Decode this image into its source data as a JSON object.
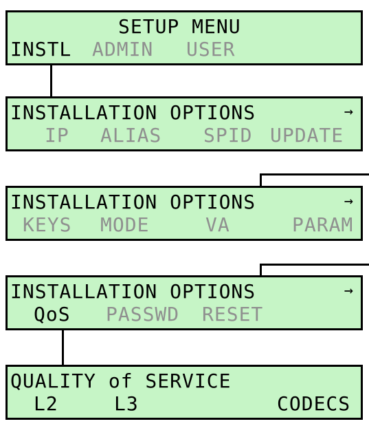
{
  "screens": [
    {
      "title": "SETUP MENU",
      "options": [
        {
          "label": "INSTL",
          "selected": true
        },
        {
          "label": "ADMIN",
          "selected": false
        },
        {
          "label": "USER",
          "selected": false
        }
      ]
    },
    {
      "title": "INSTALLATION OPTIONS",
      "arrow": "→",
      "options": [
        {
          "label": "IP",
          "selected": false
        },
        {
          "label": "ALIAS",
          "selected": false
        },
        {
          "label": "SPID",
          "selected": false
        },
        {
          "label": "UPDATE",
          "selected": false
        }
      ]
    },
    {
      "title": "INSTALLATION OPTIONS",
      "arrow": "→",
      "options": [
        {
          "label": "KEYS",
          "selected": false
        },
        {
          "label": "MODE",
          "selected": false
        },
        {
          "label": "VA",
          "selected": false
        },
        {
          "label": "PARAM",
          "selected": false
        }
      ]
    },
    {
      "title": "INSTALLATION OPTIONS",
      "arrow": "→",
      "options": [
        {
          "label": "QoS",
          "selected": true
        },
        {
          "label": "PASSWD",
          "selected": false
        },
        {
          "label": "RESET",
          "selected": false
        }
      ]
    },
    {
      "title": "QUALITY of SERVICE",
      "options": [
        {
          "label": "L2",
          "selected": true
        },
        {
          "label": "L3",
          "selected": true
        },
        {
          "label": "CODECS",
          "selected": true
        }
      ]
    }
  ],
  "colors": {
    "screen_background": "#c6f5c6",
    "selected_text": "#000000",
    "unselected_text": "#8f8f8f",
    "border": "#000000"
  }
}
